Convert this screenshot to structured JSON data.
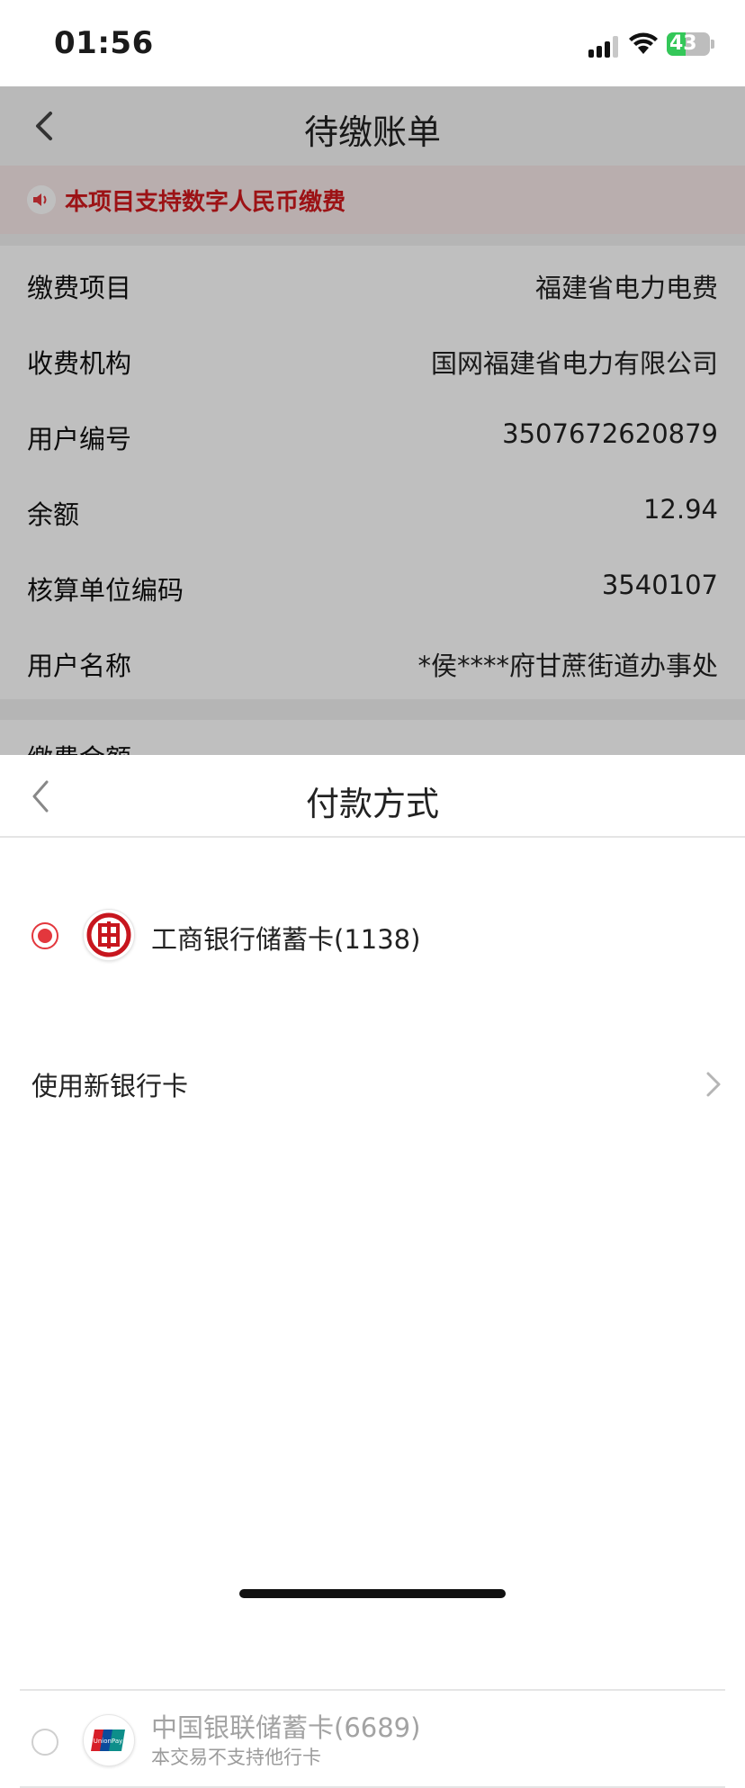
{
  "status_bar": {
    "time": "01:56",
    "battery": "43"
  },
  "bill_page": {
    "title": "待缴账单",
    "notice": "本项目支持数字人民币缴费",
    "rows": [
      {
        "label": "缴费项目",
        "value": "福建省电力电费"
      },
      {
        "label": "收费机构",
        "value": "国网福建省电力有限公司"
      },
      {
        "label": "用户编号",
        "value": "3507672620879"
      },
      {
        "label": "余额",
        "value": "12.94"
      },
      {
        "label": "核算单位编码",
        "value": "3540107"
      },
      {
        "label": "用户名称",
        "value": "*侯****府甘蔗街道办事处"
      }
    ],
    "amount_label": "缴费金额"
  },
  "payment_sheet": {
    "title": "付款方式",
    "options": [
      {
        "name": "工商银行储蓄卡(1138)",
        "selected": true
      },
      {
        "name": "中国银联储蓄卡(6689)",
        "note": "本交易不支持他行卡",
        "selected": false
      }
    ],
    "new_card": "使用新银行卡"
  },
  "colors": {
    "accent": "#e3373d",
    "notice_text": "#d0191c"
  },
  "icons": {
    "nav_back": "chevron-left-icon",
    "notice": "speaker-icon",
    "icbc": "icbc-logo-icon",
    "unionpay": "unionpay-logo-icon",
    "new_card_arrow": "chevron-right-icon"
  }
}
